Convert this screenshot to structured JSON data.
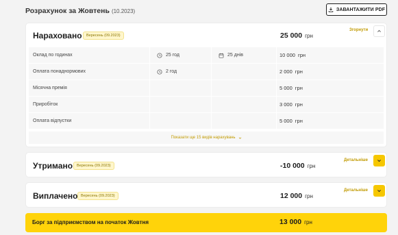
{
  "header": {
    "title": "Розрахунок за Жовтень",
    "period": "(10.2023)",
    "pdf_button": "ЗАВАНТАЖИТИ PDF"
  },
  "accrued": {
    "title": "Нараховано",
    "badge": "Вересень (09.2023)",
    "amount": "25 000",
    "currency": "грн",
    "toggle_label": "Згорнути",
    "rows": [
      {
        "name": "Оклад по годинах",
        "hours": "25 год",
        "days": "25 днів",
        "amount": "10 000",
        "currency": "грн"
      },
      {
        "name": "Оплата понаднормових",
        "hours": "2 год",
        "days": "",
        "amount": "2 000",
        "currency": "грн"
      },
      {
        "name": "Місячна премія",
        "hours": "",
        "days": "",
        "amount": "5 000",
        "currency": "грн"
      },
      {
        "name": "Приробіток",
        "hours": "",
        "days": "",
        "amount": "3 000",
        "currency": "грн"
      },
      {
        "name": "Оплата відпустки",
        "hours": "",
        "days": "",
        "amount": "5 000",
        "currency": "грн"
      }
    ],
    "show_more": "Показати ще 15 видів нарахувань"
  },
  "withheld": {
    "title": "Утримано",
    "badge": "Вересень (09.2023)",
    "amount": "-10 000",
    "currency": "грн",
    "toggle_label": "Детальніше"
  },
  "paid": {
    "title": "Виплачено",
    "badge": "Вересень (09.2023)",
    "amount": "12 000",
    "currency": "грн",
    "toggle_label": "Детальніше"
  },
  "debt": {
    "label": "Борг за підприємством на початок Жовтня",
    "amount": "13 000",
    "currency": "грн"
  },
  "colors": {
    "accent": "#f6c700",
    "badge_bg": "#fff6cc",
    "link": "#c19a00"
  }
}
